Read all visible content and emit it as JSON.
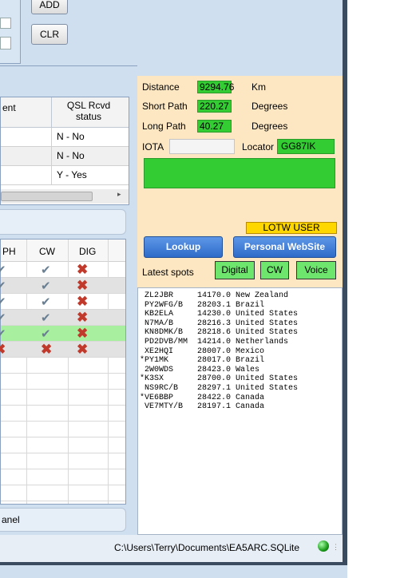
{
  "toolbar": {
    "add_label": "ADD",
    "clr_label": "CLR"
  },
  "qsl_table": {
    "headers": [
      "ent",
      "QSL Rcvd status"
    ],
    "rows": [
      {
        "status": "N - No"
      },
      {
        "status": "N - No"
      },
      {
        "status": "Y - Yes"
      }
    ]
  },
  "mode_grid": {
    "headers": [
      "PH",
      "CW",
      "DIG"
    ],
    "rows": [
      {
        "cw": "check",
        "dig": "cross"
      },
      {
        "cw": "check",
        "dig": "cross"
      },
      {
        "cw": "check",
        "dig": "cross"
      },
      {
        "cw": "check",
        "dig": "cross"
      },
      {
        "cw": "check",
        "dig": "cross"
      },
      {
        "cw": "cross",
        "dig": "cross"
      }
    ],
    "highlight_color": "#a8f0a0"
  },
  "bottom_panel_label": "anel",
  "info": {
    "distance_label": "Distance",
    "distance_value": "9294.76",
    "distance_unit": "Km",
    "short_path_label": "Short Path",
    "short_path_value": "220.27",
    "short_path_unit": "Degrees",
    "long_path_label": "Long Path",
    "long_path_value": "40.27",
    "long_path_unit": "Degrees",
    "iota_label": "IOTA",
    "iota_value": "",
    "locator_label": "Locator",
    "locator_value": "GG87IK",
    "lotw_label": "LOTW USER",
    "lookup_label": "Lookup",
    "website_label": "Personal WebSite",
    "latest_spots_label": "Latest spots",
    "digital_label": "Digital",
    "cw_label": "CW",
    "voice_label": "Voice"
  },
  "spots": [
    " ZL2JBR     14170.0 New Zealand",
    " PY2WFG/B   28203.1 Brazil",
    " KB2ELA     14230.0 United States",
    " N7MA/B     28216.3 United States",
    " KN8DMK/B   28218.6 United States",
    " PD2DVB/MM  14214.0 Netherlands",
    " XE2HQI     28007.0 Mexico",
    "*PY1MK      28017.0 Brazil",
    " 2W0WDS     28423.0 Wales",
    "*K3SX       28700.0 United States",
    " NS9RC/B    28297.1 United States",
    "*VE6BBP     28422.0 Canada",
    " VE7MTY/B   28197.1 Canada"
  ],
  "status": {
    "path": "C:\\Users\\Terry\\Documents\\EA5ARC.SQLite"
  },
  "colors": {
    "accent_green": "#33cc33",
    "info_bg": "#fde7c2",
    "lotw_yellow": "#ffd700",
    "button_blue": "#3c79d6"
  }
}
